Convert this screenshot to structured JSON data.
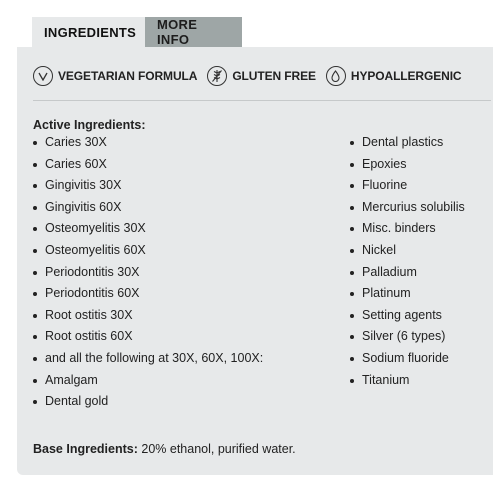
{
  "tabs": [
    {
      "label": "INGREDIENTS",
      "active": true
    },
    {
      "label": "MORE INFO",
      "active": false
    }
  ],
  "features": [
    {
      "icon": "vegetarian-v-icon",
      "label": "VEGETARIAN FORMULA"
    },
    {
      "icon": "wheat-icon",
      "label": "GLUTEN FREE"
    },
    {
      "icon": "droplet-icon",
      "label": "HYPOALLERGENIC"
    }
  ],
  "active_ingredients": {
    "title": "Active Ingredients:",
    "left": [
      "Caries 30X",
      "Caries 60X",
      "Gingivitis 30X",
      "Gingivitis 60X",
      "Osteomyelitis 30X",
      "Osteomyelitis 60X",
      "Periodontitis 30X",
      "Periodontitis 60X",
      "Root ostitis 30X",
      "Root ostitis 60X",
      "and all the following at 30X, 60X, 100X:",
      "Amalgam",
      "Dental gold"
    ],
    "right": [
      "Dental plastics",
      "Epoxies",
      "Fluorine",
      "Mercurius solubilis",
      "Misc. binders",
      "Nickel",
      "Palladium",
      "Platinum",
      "Setting agents",
      "Silver (6 types)",
      "Sodium fluoride",
      "Titanium"
    ]
  },
  "base_ingredients": {
    "label": "Base Ingredients:",
    "value": "20% ethanol, purified water."
  },
  "colors": {
    "panel_bg": "#e7e9ea",
    "inactive_tab_bg": "#9ea6a6"
  }
}
